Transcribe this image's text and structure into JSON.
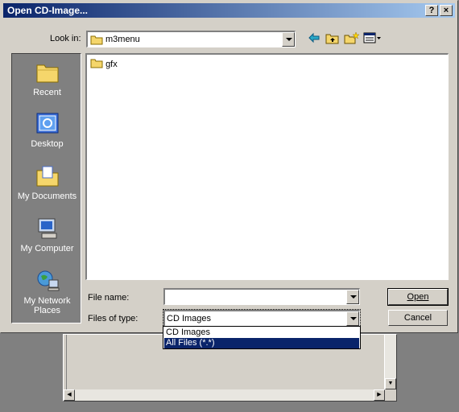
{
  "window": {
    "title": "Open CD-Image...",
    "help_btn": "?",
    "close_btn": "×"
  },
  "look_in": {
    "label": "Look in:",
    "value": "m3menu"
  },
  "places": [
    {
      "label": "Recent",
      "icon": "recent-folder-icon"
    },
    {
      "label": "Desktop",
      "icon": "desktop-icon"
    },
    {
      "label": "My Documents",
      "icon": "my-documents-icon"
    },
    {
      "label": "My Computer",
      "icon": "my-computer-icon"
    },
    {
      "label": "My Network Places",
      "icon": "network-places-icon"
    }
  ],
  "files": [
    {
      "name": "gfx",
      "icon": "folder-icon"
    }
  ],
  "file_name": {
    "label": "File name:",
    "value": ""
  },
  "file_type": {
    "label": "Files of type:",
    "value": "CD Images",
    "options": [
      "CD Images",
      "All Files (*.*)"
    ],
    "highlighted": "All Files (*.*)"
  },
  "buttons": {
    "open": "Open",
    "cancel": "Cancel"
  },
  "colors": {
    "titlebar": "#0a246a",
    "face": "#d4d0c8",
    "highlight": "#0a246a"
  }
}
